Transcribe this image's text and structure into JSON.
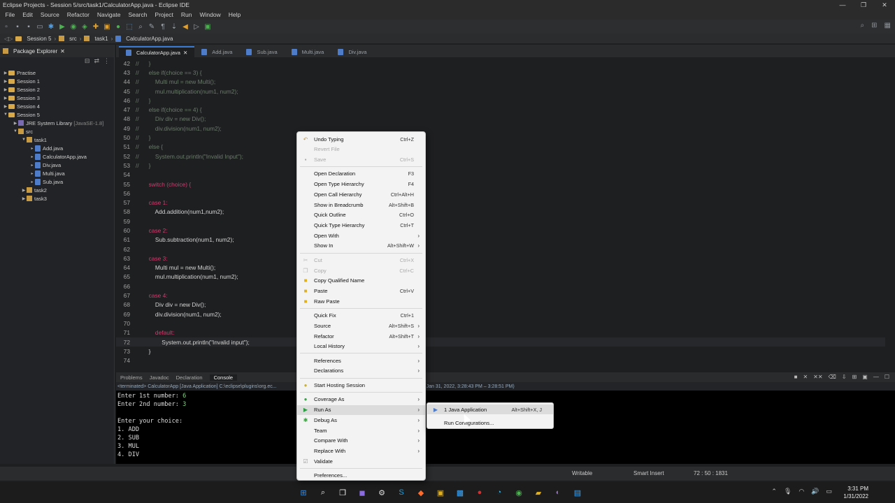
{
  "window": {
    "title": "Eclipse Projects - Session 5/src/task1/CalculatorApp.java - Eclipse IDE",
    "controls": [
      "—",
      "❐",
      "✕"
    ]
  },
  "menu": [
    "File",
    "Edit",
    "Source",
    "Refactor",
    "Navigate",
    "Search",
    "Project",
    "Run",
    "Window",
    "Help"
  ],
  "breadcrumb": [
    "Session 5",
    "src",
    "task1",
    "CalculatorApp.java"
  ],
  "package_explorer": {
    "title": "Package Explorer",
    "items": [
      {
        "label": "Practise"
      },
      {
        "label": "Session 1"
      },
      {
        "label": "Session 2"
      },
      {
        "label": "Session 3"
      },
      {
        "label": "Session 4"
      },
      {
        "label": "Session 5"
      },
      {
        "label": "JRE System Library",
        "suffix": "[JavaSE-1.8]"
      },
      {
        "label": "src"
      },
      {
        "label": "task1"
      },
      {
        "label": "Add.java"
      },
      {
        "label": "CalculatorApp.java"
      },
      {
        "label": "Div.java"
      },
      {
        "label": "Multi.java"
      },
      {
        "label": "Sub.java"
      },
      {
        "label": "task2"
      },
      {
        "label": "task3"
      }
    ]
  },
  "editor": {
    "tabs": [
      "CalculatorApp.java",
      "Add.java",
      "Sub.java",
      "Multi.java",
      "Div.java"
    ],
    "lines": [
      {
        "n": "42",
        "c": "//      }"
      },
      {
        "n": "43",
        "c": "//      else if(choice == 3) {"
      },
      {
        "n": "44",
        "c": "//          Multi mul = new Multi();"
      },
      {
        "n": "45",
        "c": "//          mul.multiplication(num1, num2);"
      },
      {
        "n": "46",
        "c": "//      }"
      },
      {
        "n": "47",
        "c": "//      else if(choice == 4) {"
      },
      {
        "n": "48",
        "c": "//          Div div = new Div();"
      },
      {
        "n": "49",
        "c": "//          div.division(num1, num2);"
      },
      {
        "n": "50",
        "c": "//      }"
      },
      {
        "n": "51",
        "c": "//      else {"
      },
      {
        "n": "52",
        "c": "//          System.out.println(\"Invalid Input\");"
      },
      {
        "n": "53",
        "c": "//      }"
      },
      {
        "n": "54",
        "c": ""
      },
      {
        "n": "55",
        "c": "        switch (choice) {"
      },
      {
        "n": "56",
        "c": ""
      },
      {
        "n": "57",
        "c": "        case 1:"
      },
      {
        "n": "58",
        "c": "            Add.addition(num1,num2);"
      },
      {
        "n": "59",
        "c": ""
      },
      {
        "n": "60",
        "c": "        case 2:"
      },
      {
        "n": "61",
        "c": "            Sub.subtraction(num1, num2);"
      },
      {
        "n": "62",
        "c": ""
      },
      {
        "n": "63",
        "c": "        case 3:"
      },
      {
        "n": "64",
        "c": "            Multi mul = new Multi();"
      },
      {
        "n": "65",
        "c": "            mul.multiplication(num1, num2);"
      },
      {
        "n": "66",
        "c": ""
      },
      {
        "n": "67",
        "c": "        case 4:"
      },
      {
        "n": "68",
        "c": "            Div div = new Div();"
      },
      {
        "n": "69",
        "c": "            div.division(num1, num2);"
      },
      {
        "n": "70",
        "c": ""
      },
      {
        "n": "71",
        "c": "            default:"
      },
      {
        "n": "72",
        "c": "                System.out.println(\"Invalid input\");"
      },
      {
        "n": "73",
        "c": "        }"
      },
      {
        "n": "74",
        "c": ""
      }
    ]
  },
  "bottom_panel": {
    "tabs": [
      "Problems",
      "Javadoc",
      "Declaration",
      "Console"
    ],
    "terminated_line": "<terminated> CalculatorApp [Java Application] C:\\eclipse\\plugins\\org.ec...",
    "terminated_tail": "v20210721-1149\\jre\\bin\\javaw.exe  (Jan 31, 2022, 3:28:43 PM – 3:28:51 PM)",
    "console": [
      {
        "t": "Enter 1st number:  ",
        "v": "6"
      },
      {
        "t": "Enter 2nd number:  ",
        "v": "3"
      },
      {
        "t": "",
        "v": ""
      },
      {
        "t": "Enter your choice:",
        "v": ""
      },
      {
        "t": "1. ADD",
        "v": ""
      },
      {
        "t": "2. SUB",
        "v": ""
      },
      {
        "t": "3. MUL",
        "v": ""
      },
      {
        "t": "4. DIV",
        "v": ""
      }
    ]
  },
  "context_menu": [
    {
      "label": "Undo Typing",
      "shortcut": "Ctrl+Z",
      "icon": "undo-icon",
      "glyph": "↶",
      "color": "#d99a2b"
    },
    {
      "label": "Revert File",
      "shortcut": "",
      "disabled": true
    },
    {
      "label": "Save",
      "shortcut": "Ctrl+S",
      "disabled": true,
      "icon": "save-icon",
      "glyph": "▪",
      "color": "#aaaaaa"
    },
    {
      "sep": true
    },
    {
      "label": "Open Declaration",
      "shortcut": "F3"
    },
    {
      "label": "Open Type Hierarchy",
      "shortcut": "F4"
    },
    {
      "label": "Open Call Hierarchy",
      "shortcut": "Ctrl+Alt+H"
    },
    {
      "label": "Show in Breadcrumb",
      "shortcut": "Alt+Shift+B"
    },
    {
      "label": "Quick Outline",
      "shortcut": "Ctrl+O"
    },
    {
      "label": "Quick Type Hierarchy",
      "shortcut": "Ctrl+T"
    },
    {
      "label": "Open With",
      "shortcut": "",
      "submenu": true
    },
    {
      "label": "Show In",
      "shortcut": "Alt+Shift+W",
      "submenu": true
    },
    {
      "sep": true
    },
    {
      "label": "Cut",
      "shortcut": "Ctrl+X",
      "disabled": true,
      "icon": "cut-icon",
      "glyph": "✂",
      "color": "#bbbbbb"
    },
    {
      "label": "Copy",
      "shortcut": "Ctrl+C",
      "disabled": true,
      "icon": "copy-icon",
      "glyph": "❐",
      "color": "#bbbbbb"
    },
    {
      "label": "Copy Qualified Name",
      "shortcut": "",
      "icon": "copy-qualified-icon",
      "glyph": "■",
      "color": "#e0b020"
    },
    {
      "label": "Paste",
      "shortcut": "Ctrl+V",
      "icon": "paste-icon",
      "glyph": "■",
      "color": "#e0b020"
    },
    {
      "label": "Raw Paste",
      "shortcut": "",
      "icon": "raw-paste-icon",
      "glyph": "■",
      "color": "#e0b020"
    },
    {
      "sep": true
    },
    {
      "label": "Quick Fix",
      "shortcut": "Ctrl+1"
    },
    {
      "label": "Source",
      "shortcut": "Alt+Shift+S",
      "submenu": true
    },
    {
      "label": "Refactor",
      "shortcut": "Alt+Shift+T",
      "submenu": true
    },
    {
      "label": "Local History",
      "shortcut": "",
      "submenu": true
    },
    {
      "sep": true
    },
    {
      "label": "References",
      "shortcut": "",
      "submenu": true
    },
    {
      "label": "Declarations",
      "shortcut": "",
      "submenu": true
    },
    {
      "sep": true
    },
    {
      "label": "Start Hosting Session",
      "shortcut": "",
      "icon": "hosting-icon",
      "glyph": "●",
      "color": "#c8b040"
    },
    {
      "sep": true
    },
    {
      "label": "Coverage As",
      "shortcut": "",
      "submenu": true,
      "icon": "coverage-icon",
      "glyph": "●",
      "color": "#3fa34d"
    },
    {
      "label": "Run As",
      "shortcut": "",
      "submenu": true,
      "icon": "run-icon",
      "glyph": "▶",
      "color": "#2e9e44",
      "highlight": true
    },
    {
      "label": "Debug As",
      "shortcut": "",
      "submenu": true,
      "icon": "debug-icon",
      "glyph": "✱",
      "color": "#3aa040"
    },
    {
      "label": "Team",
      "shortcut": "",
      "submenu": true
    },
    {
      "label": "Compare With",
      "shortcut": "",
      "submenu": true
    },
    {
      "label": "Replace With",
      "shortcut": "",
      "submenu": true
    },
    {
      "label": "Validate",
      "shortcut": "",
      "icon": "validate-icon",
      "glyph": "☑",
      "color": "#999999"
    },
    {
      "sep": true
    },
    {
      "label": "Preferences...",
      "shortcut": ""
    }
  ],
  "run_as_submenu": [
    {
      "label": "1 Java Application",
      "shortcut": "Alt+Shift+X, J"
    },
    {
      "label": "Run Configurations...",
      "shortcut": ""
    }
  ],
  "statusbar": {
    "writable": "Writable",
    "insert": "Smart Insert",
    "position": "72 : 50 : 1831"
  },
  "taskbar": {
    "time": "3:31 PM",
    "date": "1/31/2022"
  }
}
